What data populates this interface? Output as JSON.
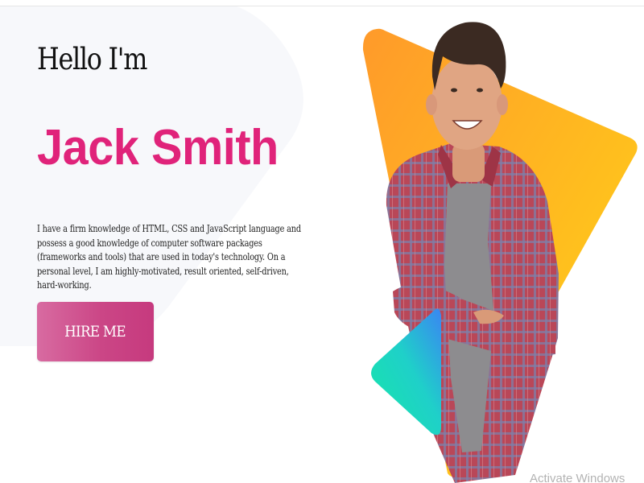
{
  "hero": {
    "greeting": "Hello I'm",
    "name": "Jack Smith",
    "bio": "I have a firm knowledge of HTML, CSS and JavaScript language and possess a good knowledge of computer software packages (frameworks and tools) that are used in today's technology. On a personal level, I am highly-motivated, result oriented, self-driven, hard-working.",
    "cta_label": "HIRE ME"
  },
  "overlay": {
    "watermark": "Activate Windows"
  },
  "colors": {
    "name_accent": "#e0237a",
    "button_gradient_start": "#d86ba1",
    "button_gradient_end": "#c63a7e",
    "triangle_orange": "#ff9d26",
    "triangle_yellow": "#ffd11a",
    "accent_triangle_teal": "#1de0b5",
    "accent_triangle_blue": "#3a8df0"
  }
}
